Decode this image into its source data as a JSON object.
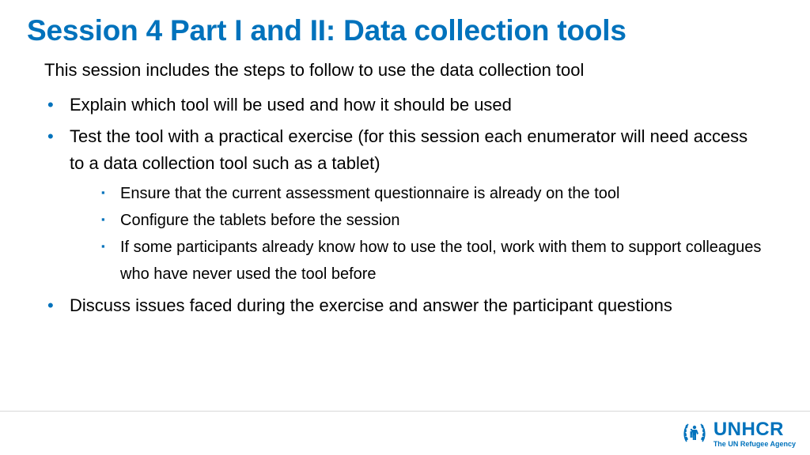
{
  "title": "Session 4 Part I and II: Data collection tools",
  "intro": "This session includes the steps to follow to use the data collection tool",
  "b1": " Explain which tool will be used and how it should be used",
  "b2": "Test the tool with a practical exercise (for this session each enumerator will need access to a data collection tool such as a tablet)",
  "b2s1": "Ensure that the current assessment questionnaire is already on the tool",
  "b2s2": "Configure the tablets before the session",
  "b2s3": "If some participants already know how to use the tool, work with them to support colleagues who have never used the tool before",
  "b3": "Discuss issues faced during the exercise and answer the participant questions",
  "logo": {
    "name": "UNHCR",
    "tag": "The UN Refugee Agency"
  }
}
